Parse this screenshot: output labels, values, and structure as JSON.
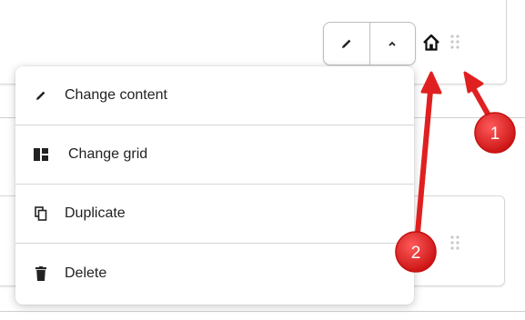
{
  "toolbar": {
    "edit_icon": "pencil-icon",
    "collapse_icon": "chevron-up-icon",
    "home_icon": "home-icon",
    "drag_icon": "drag-handle-icon"
  },
  "menu": {
    "items": [
      {
        "label": "Change content",
        "icon": "pencil-icon"
      },
      {
        "label": "Change grid",
        "icon": "grid-layout-icon"
      },
      {
        "label": "Duplicate",
        "icon": "copy-icon"
      },
      {
        "label": "Delete",
        "icon": "trash-icon"
      }
    ]
  },
  "annotations": {
    "badge_1": "1",
    "badge_2": "2",
    "color": "#e02020"
  }
}
